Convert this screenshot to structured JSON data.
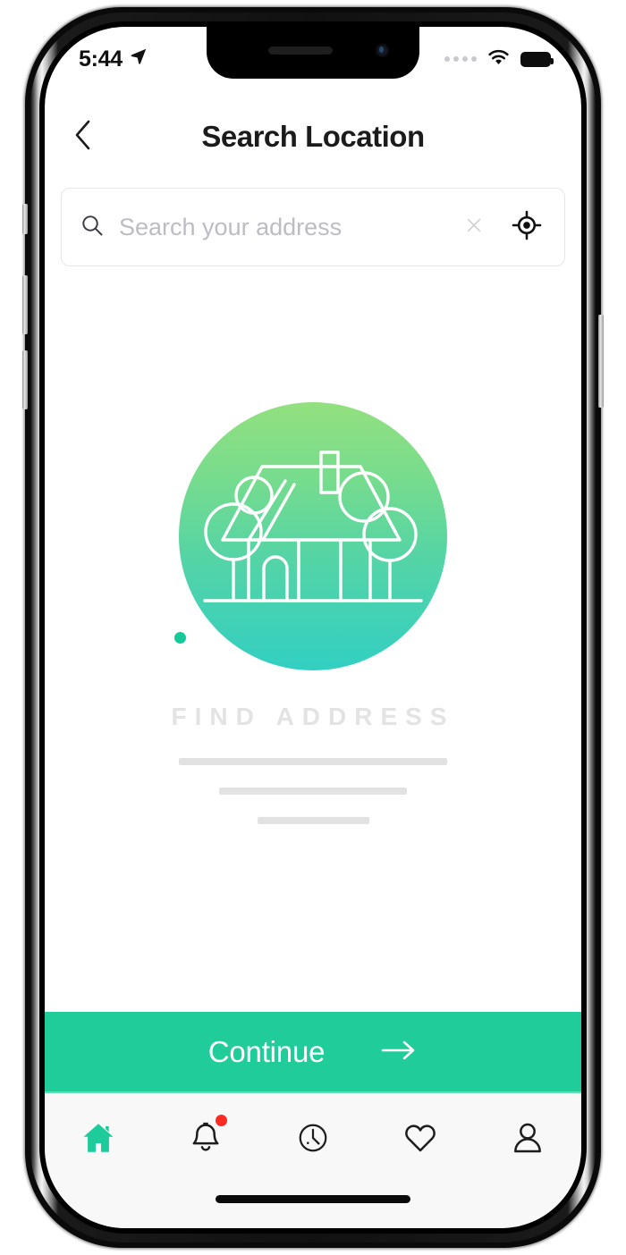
{
  "statusbar": {
    "time": "5:44",
    "location_icon": "location-arrow-icon",
    "signal_icon": "signal-dots-icon",
    "wifi_icon": "wifi-icon",
    "battery_icon": "battery-full-icon"
  },
  "header": {
    "back_icon": "chevron-left-icon",
    "title": "Search Location"
  },
  "search": {
    "search_icon": "search-icon",
    "value": "",
    "placeholder": "Search your address",
    "clear_icon": "close-icon",
    "locate_icon": "crosshair-target-icon"
  },
  "empty_state": {
    "illustration_icon": "house-with-trees-icon",
    "title": "FIND ADDRESS",
    "accent_dot_color": "#16c99b",
    "gradient_from": "#93e07f",
    "gradient_to": "#32cfc2",
    "placeholder_bars": [
      300,
      210,
      125
    ]
  },
  "continue": {
    "label": "Continue",
    "arrow_icon": "arrow-right-icon",
    "color": "#21cc9b"
  },
  "tabbar": {
    "separator_color": "#64dcb5",
    "items": [
      {
        "name": "home",
        "icon": "home-icon",
        "active": true,
        "badge": false
      },
      {
        "name": "notifications",
        "icon": "bell-icon",
        "active": false,
        "badge": true
      },
      {
        "name": "history",
        "icon": "clock-icon",
        "active": false,
        "badge": false
      },
      {
        "name": "favorites",
        "icon": "heart-icon",
        "active": false,
        "badge": false
      },
      {
        "name": "profile",
        "icon": "person-icon",
        "active": false,
        "badge": false
      }
    ],
    "active_color": "#1ecb9b",
    "inactive_color": "#1d1d1d",
    "badge_color": "#fb2a22"
  }
}
